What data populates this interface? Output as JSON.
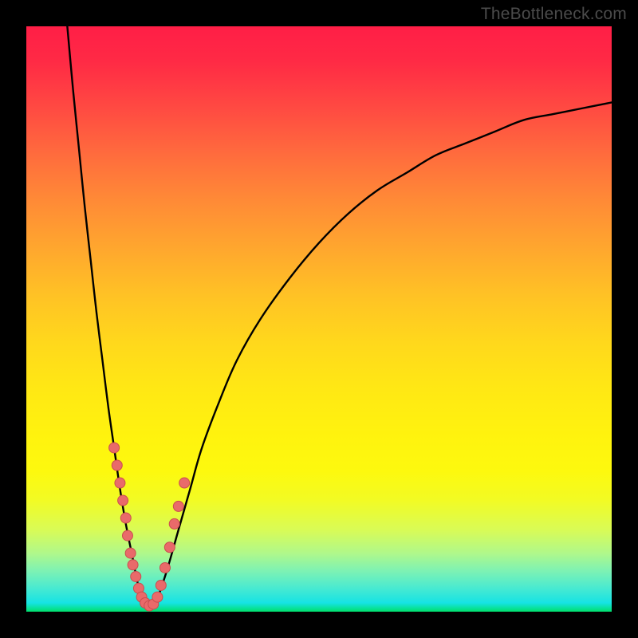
{
  "watermark": "TheBottleneck.com",
  "colors": {
    "frame": "#000000",
    "curve": "#000000",
    "dot_fill": "#e96a6a",
    "dot_stroke": "#ca4e4e"
  },
  "chart_data": {
    "type": "line",
    "title": "",
    "xlabel": "",
    "ylabel": "",
    "xlim": [
      0,
      100
    ],
    "ylim": [
      0,
      100
    ],
    "grid": false,
    "series": [
      {
        "name": "left-branch",
        "x": [
          7,
          8,
          9,
          10,
          11,
          12,
          13,
          14,
          15,
          16,
          17,
          18,
          19,
          20
        ],
        "values": [
          100,
          89,
          79,
          69,
          60,
          51,
          43,
          35,
          28,
          21,
          15,
          10,
          5,
          1
        ]
      },
      {
        "name": "right-branch",
        "x": [
          22,
          24,
          26,
          28,
          30,
          33,
          36,
          40,
          45,
          50,
          55,
          60,
          65,
          70,
          75,
          80,
          85,
          90,
          95,
          100
        ],
        "values": [
          1,
          7,
          14,
          21,
          28,
          36,
          43,
          50,
          57,
          63,
          68,
          72,
          75,
          78,
          80,
          82,
          84,
          85,
          86,
          87
        ]
      }
    ],
    "annotations": {
      "dots_note": "scatter markers visible near the cusp, along both branches, in the lower ~25% of the y-range",
      "dots": [
        {
          "x": 15.0,
          "y": 28
        },
        {
          "x": 15.5,
          "y": 25
        },
        {
          "x": 16.0,
          "y": 22
        },
        {
          "x": 16.5,
          "y": 19
        },
        {
          "x": 17.0,
          "y": 16
        },
        {
          "x": 17.3,
          "y": 13
        },
        {
          "x": 17.8,
          "y": 10
        },
        {
          "x": 18.2,
          "y": 8
        },
        {
          "x": 18.7,
          "y": 6
        },
        {
          "x": 19.2,
          "y": 4
        },
        {
          "x": 19.7,
          "y": 2.5
        },
        {
          "x": 20.3,
          "y": 1.5
        },
        {
          "x": 21.0,
          "y": 1.0
        },
        {
          "x": 21.7,
          "y": 1.3
        },
        {
          "x": 22.4,
          "y": 2.5
        },
        {
          "x": 23.0,
          "y": 4.5
        },
        {
          "x": 23.7,
          "y": 7.5
        },
        {
          "x": 24.5,
          "y": 11
        },
        {
          "x": 25.3,
          "y": 15
        },
        {
          "x": 26.0,
          "y": 18
        },
        {
          "x": 27.0,
          "y": 22
        }
      ]
    }
  }
}
